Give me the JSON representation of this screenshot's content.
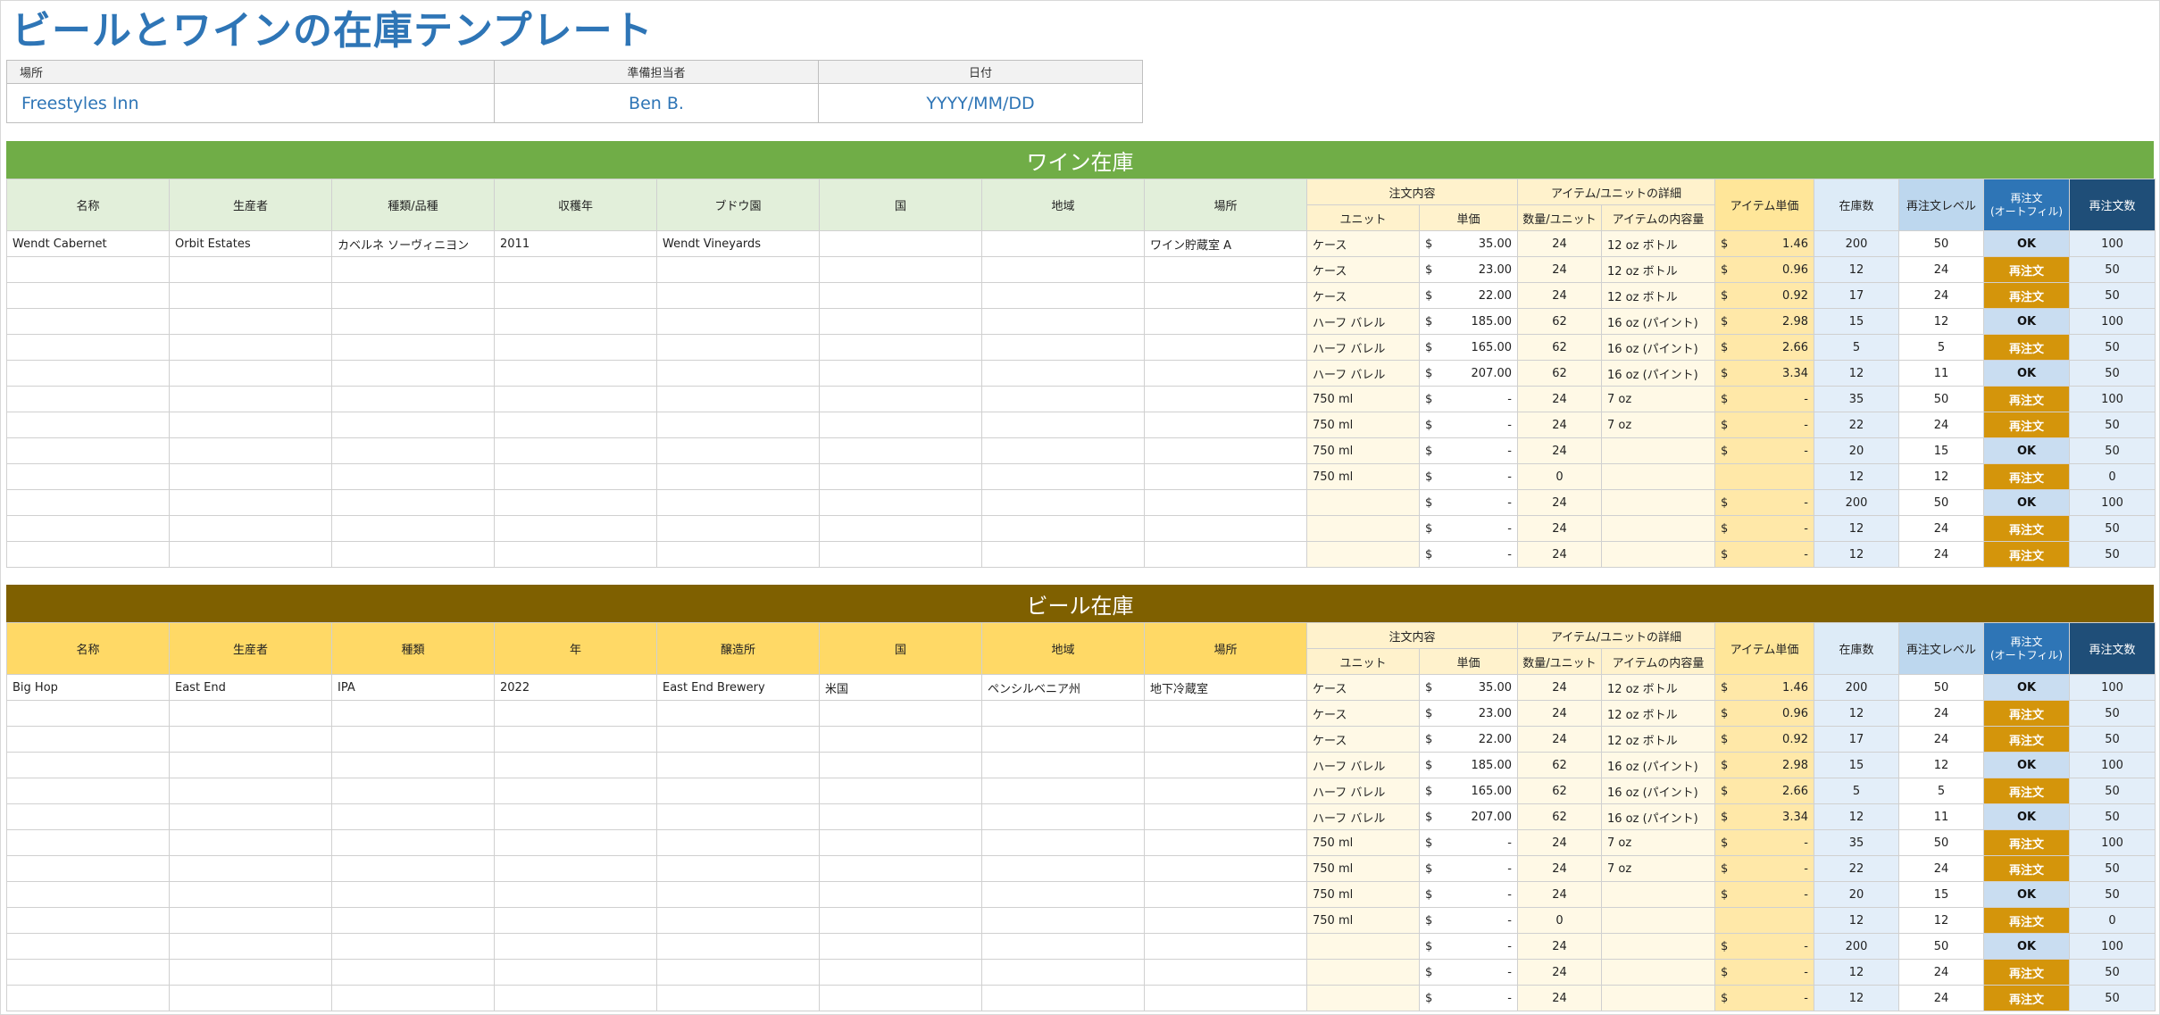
{
  "title": "ビールとワインの在庫テンプレート",
  "info": {
    "headers": [
      "場所",
      "準備担当者",
      "日付"
    ],
    "values": [
      "Freestyles Inn",
      "Ben B.",
      "YYYY/MM/DD"
    ]
  },
  "wine": {
    "banner": "ワイン在庫",
    "columns": [
      "名称",
      "生産者",
      "種類/品種",
      "収穫年",
      "ブドウ園",
      "国",
      "地域",
      "場所"
    ],
    "order_group": "注文内容",
    "unit_group": "アイテム/ユニットの詳細",
    "unit_label": "ユニット",
    "price_label": "単価",
    "qty_label": "数量/ユニット",
    "content_label": "アイテムの内容量",
    "item_price_label": "アイテム単価",
    "stock_label": "在庫数",
    "reorder_level_label": "再注文レベル",
    "reorder_auto_label": "再注文\n(オートフィル)",
    "reorder_qty_label": "再注文数",
    "rows": [
      {
        "info": [
          "Wendt Cabernet",
          "Orbit Estates",
          "カベルネ ソーヴィニヨン",
          "2011",
          "Wendt Vineyards",
          "",
          "",
          "ワイン貯蔵室 A"
        ],
        "unit": "ケース",
        "price": "35.00",
        "qty": "24",
        "content": "12 oz ボトル",
        "item_price": "1.46",
        "stock": "200",
        "level": "50",
        "status": "OK",
        "reorder": "100"
      },
      {
        "info": [
          "",
          "",
          "",
          "",
          "",
          "",
          "",
          ""
        ],
        "unit": "ケース",
        "price": "23.00",
        "qty": "24",
        "content": "12 oz ボトル",
        "item_price": "0.96",
        "stock": "12",
        "level": "24",
        "status": "再注文",
        "reorder": "50"
      },
      {
        "info": [
          "",
          "",
          "",
          "",
          "",
          "",
          "",
          ""
        ],
        "unit": "ケース",
        "price": "22.00",
        "qty": "24",
        "content": "12 oz ボトル",
        "item_price": "0.92",
        "stock": "17",
        "level": "24",
        "status": "再注文",
        "reorder": "50"
      },
      {
        "info": [
          "",
          "",
          "",
          "",
          "",
          "",
          "",
          ""
        ],
        "unit": "ハーフ バレル",
        "price": "185.00",
        "qty": "62",
        "content": "16 oz (パイント)",
        "item_price": "2.98",
        "stock": "15",
        "level": "12",
        "status": "OK",
        "reorder": "100"
      },
      {
        "info": [
          "",
          "",
          "",
          "",
          "",
          "",
          "",
          ""
        ],
        "unit": "ハーフ バレル",
        "price": "165.00",
        "qty": "62",
        "content": "16 oz (パイント)",
        "item_price": "2.66",
        "stock": "5",
        "level": "5",
        "status": "再注文",
        "reorder": "50"
      },
      {
        "info": [
          "",
          "",
          "",
          "",
          "",
          "",
          "",
          ""
        ],
        "unit": "ハーフ バレル",
        "price": "207.00",
        "qty": "62",
        "content": "16 oz (パイント)",
        "item_price": "3.34",
        "stock": "12",
        "level": "11",
        "status": "OK",
        "reorder": "50"
      },
      {
        "info": [
          "",
          "",
          "",
          "",
          "",
          "",
          "",
          ""
        ],
        "unit": "750 ml",
        "price": "-",
        "qty": "24",
        "content": "7 oz",
        "item_price": "-",
        "stock": "35",
        "level": "50",
        "status": "再注文",
        "reorder": "100"
      },
      {
        "info": [
          "",
          "",
          "",
          "",
          "",
          "",
          "",
          ""
        ],
        "unit": "750 ml",
        "price": "-",
        "qty": "24",
        "content": "7 oz",
        "item_price": "-",
        "stock": "22",
        "level": "24",
        "status": "再注文",
        "reorder": "50"
      },
      {
        "info": [
          "",
          "",
          "",
          "",
          "",
          "",
          "",
          ""
        ],
        "unit": "750 ml",
        "price": "-",
        "qty": "24",
        "content": "",
        "item_price": "-",
        "stock": "20",
        "level": "15",
        "status": "OK",
        "reorder": "50"
      },
      {
        "info": [
          "",
          "",
          "",
          "",
          "",
          "",
          "",
          ""
        ],
        "unit": "750 ml",
        "price": "-",
        "qty": "0",
        "content": "",
        "item_price": "",
        "stock": "12",
        "level": "12",
        "status": "再注文",
        "reorder": "0"
      },
      {
        "info": [
          "",
          "",
          "",
          "",
          "",
          "",
          "",
          ""
        ],
        "unit": "",
        "price": "-",
        "qty": "24",
        "content": "",
        "item_price": "-",
        "stock": "200",
        "level": "50",
        "status": "OK",
        "reorder": "100"
      },
      {
        "info": [
          "",
          "",
          "",
          "",
          "",
          "",
          "",
          ""
        ],
        "unit": "",
        "price": "-",
        "qty": "24",
        "content": "",
        "item_price": "-",
        "stock": "12",
        "level": "24",
        "status": "再注文",
        "reorder": "50"
      },
      {
        "info": [
          "",
          "",
          "",
          "",
          "",
          "",
          "",
          ""
        ],
        "unit": "",
        "price": "-",
        "qty": "24",
        "content": "",
        "item_price": "-",
        "stock": "12",
        "level": "24",
        "status": "再注文",
        "reorder": "50"
      }
    ]
  },
  "beer": {
    "banner": "ビール在庫",
    "columns": [
      "名称",
      "生産者",
      "種類",
      "年",
      "醸造所",
      "国",
      "地域",
      "場所"
    ],
    "order_group": "注文内容",
    "unit_group": "アイテム/ユニットの詳細",
    "unit_label": "ユニット",
    "price_label": "単価",
    "qty_label": "数量/ユニット",
    "content_label": "アイテムの内容量",
    "item_price_label": "アイテム単価",
    "stock_label": "在庫数",
    "reorder_level_label": "再注文レベル",
    "reorder_auto_label": "再注文\n(オートフィル)",
    "reorder_qty_label": "再注文数",
    "rows": [
      {
        "info": [
          "Big Hop",
          "East End",
          "IPA",
          "2022",
          "East End Brewery",
          "米国",
          "ペンシルベニア州",
          "地下冷蔵室"
        ],
        "unit": "ケース",
        "price": "35.00",
        "qty": "24",
        "content": "12 oz ボトル",
        "item_price": "1.46",
        "stock": "200",
        "level": "50",
        "status": "OK",
        "reorder": "100"
      },
      {
        "info": [
          "",
          "",
          "",
          "",
          "",
          "",
          "",
          ""
        ],
        "unit": "ケース",
        "price": "23.00",
        "qty": "24",
        "content": "12 oz ボトル",
        "item_price": "0.96",
        "stock": "12",
        "level": "24",
        "status": "再注文",
        "reorder": "50"
      },
      {
        "info": [
          "",
          "",
          "",
          "",
          "",
          "",
          "",
          ""
        ],
        "unit": "ケース",
        "price": "22.00",
        "qty": "24",
        "content": "12 oz ボトル",
        "item_price": "0.92",
        "stock": "17",
        "level": "24",
        "status": "再注文",
        "reorder": "50"
      },
      {
        "info": [
          "",
          "",
          "",
          "",
          "",
          "",
          "",
          ""
        ],
        "unit": "ハーフ バレル",
        "price": "185.00",
        "qty": "62",
        "content": "16 oz (パイント)",
        "item_price": "2.98",
        "stock": "15",
        "level": "12",
        "status": "OK",
        "reorder": "100"
      },
      {
        "info": [
          "",
          "",
          "",
          "",
          "",
          "",
          "",
          ""
        ],
        "unit": "ハーフ バレル",
        "price": "165.00",
        "qty": "62",
        "content": "16 oz (パイント)",
        "item_price": "2.66",
        "stock": "5",
        "level": "5",
        "status": "再注文",
        "reorder": "50"
      },
      {
        "info": [
          "",
          "",
          "",
          "",
          "",
          "",
          "",
          ""
        ],
        "unit": "ハーフ バレル",
        "price": "207.00",
        "qty": "62",
        "content": "16 oz (パイント)",
        "item_price": "3.34",
        "stock": "12",
        "level": "11",
        "status": "OK",
        "reorder": "50"
      },
      {
        "info": [
          "",
          "",
          "",
          "",
          "",
          "",
          "",
          ""
        ],
        "unit": "750 ml",
        "price": "-",
        "qty": "24",
        "content": "7 oz",
        "item_price": "-",
        "stock": "35",
        "level": "50",
        "status": "再注文",
        "reorder": "100"
      },
      {
        "info": [
          "",
          "",
          "",
          "",
          "",
          "",
          "",
          ""
        ],
        "unit": "750 ml",
        "price": "-",
        "qty": "24",
        "content": "7 oz",
        "item_price": "-",
        "stock": "22",
        "level": "24",
        "status": "再注文",
        "reorder": "50"
      },
      {
        "info": [
          "",
          "",
          "",
          "",
          "",
          "",
          "",
          ""
        ],
        "unit": "750 ml",
        "price": "-",
        "qty": "24",
        "content": "",
        "item_price": "-",
        "stock": "20",
        "level": "15",
        "status": "OK",
        "reorder": "50"
      },
      {
        "info": [
          "",
          "",
          "",
          "",
          "",
          "",
          "",
          ""
        ],
        "unit": "750 ml",
        "price": "-",
        "qty": "0",
        "content": "",
        "item_price": "",
        "stock": "12",
        "level": "12",
        "status": "再注文",
        "reorder": "0"
      },
      {
        "info": [
          "",
          "",
          "",
          "",
          "",
          "",
          "",
          ""
        ],
        "unit": "",
        "price": "-",
        "qty": "24",
        "content": "",
        "item_price": "-",
        "stock": "200",
        "level": "50",
        "status": "OK",
        "reorder": "100"
      },
      {
        "info": [
          "",
          "",
          "",
          "",
          "",
          "",
          "",
          ""
        ],
        "unit": "",
        "price": "-",
        "qty": "24",
        "content": "",
        "item_price": "-",
        "stock": "12",
        "level": "24",
        "status": "再注文",
        "reorder": "50"
      },
      {
        "info": [
          "",
          "",
          "",
          "",
          "",
          "",
          "",
          ""
        ],
        "unit": "",
        "price": "-",
        "qty": "24",
        "content": "",
        "item_price": "-",
        "stock": "12",
        "level": "24",
        "status": "再注文",
        "reorder": "50"
      }
    ]
  },
  "currency_symbol": "$",
  "colors": {
    "title": "#2e75b6",
    "wine_banner": "#70ad47",
    "beer_banner": "#7f6000",
    "reorder_badge": "#d4950b",
    "ok_badge": "#c9ddf1"
  }
}
